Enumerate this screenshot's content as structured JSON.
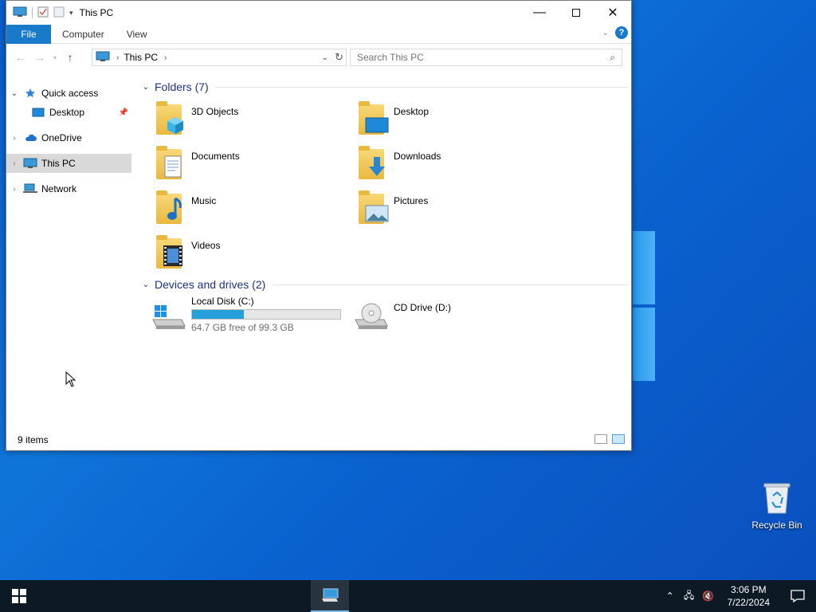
{
  "window": {
    "title": "This PC",
    "ribbon": {
      "file": "File",
      "computer": "Computer",
      "view": "View"
    },
    "address": {
      "crumb": "This PC"
    },
    "search": {
      "placeholder": "Search This PC"
    },
    "nav_pane": {
      "quick_access": "Quick access",
      "desktop": "Desktop",
      "onedrive": "OneDrive",
      "this_pc": "This PC",
      "network": "Network"
    },
    "folders_header": "Folders (7)",
    "folders": [
      {
        "label": "3D Objects",
        "icon": "3d-objects-icon"
      },
      {
        "label": "Desktop",
        "icon": "desktop-folder-icon"
      },
      {
        "label": "Documents",
        "icon": "documents-icon"
      },
      {
        "label": "Downloads",
        "icon": "downloads-icon"
      },
      {
        "label": "Music",
        "icon": "music-icon"
      },
      {
        "label": "Pictures",
        "icon": "pictures-icon"
      },
      {
        "label": "Videos",
        "icon": "videos-icon"
      }
    ],
    "drives_header": "Devices and drives (2)",
    "drives": [
      {
        "label": "Local Disk (C:)",
        "free": "64.7 GB free of 99.3 GB",
        "used_fraction": 0.348
      },
      {
        "label": "CD Drive (D:)"
      }
    ],
    "status": "9 items"
  },
  "desktop": {
    "recycle_bin": "Recycle Bin"
  },
  "taskbar": {
    "time": "3:06 PM",
    "date": "7/22/2024"
  },
  "colors": {
    "accent": "#1979ca",
    "disk_bar": "#26a0da"
  }
}
